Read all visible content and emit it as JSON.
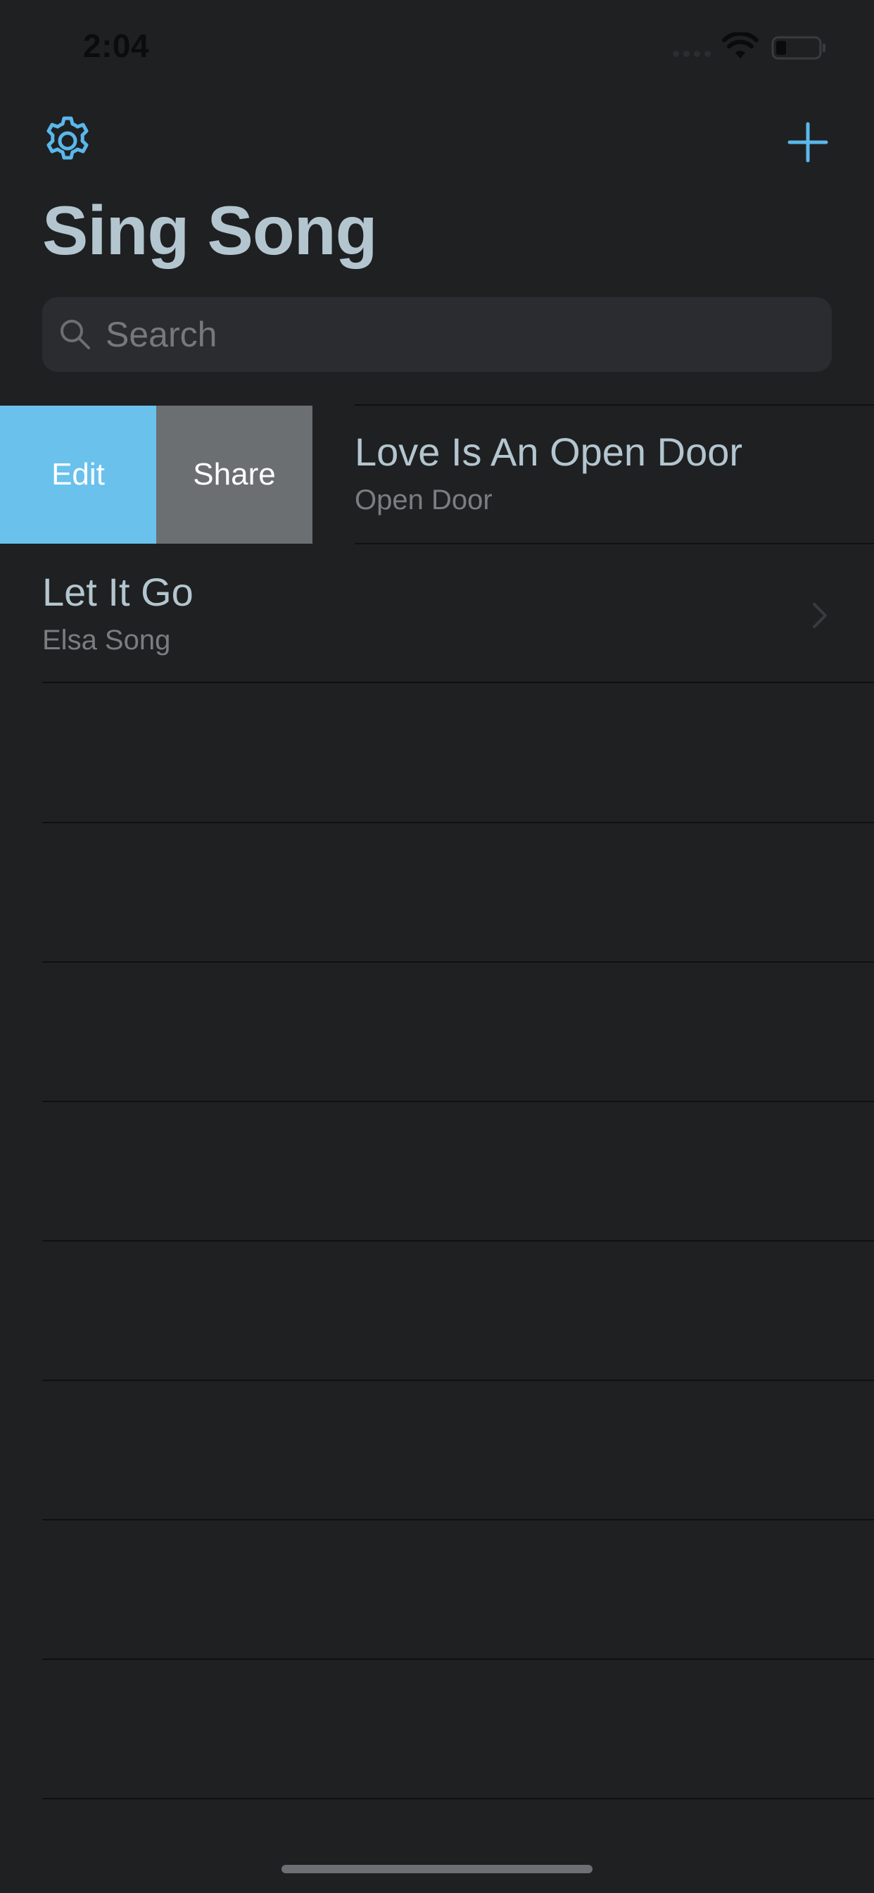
{
  "status_bar": {
    "time": "2:04"
  },
  "nav": {
    "settings_icon": "gear-icon",
    "add_icon": "plus-icon",
    "title": "Sing Song"
  },
  "search": {
    "placeholder": "Search",
    "icon": "search-icon"
  },
  "swipe_actions": {
    "edit_label": "Edit",
    "share_label": "Share",
    "edit_color": "#69c1ec",
    "share_color": "#6b6f72"
  },
  "songs": [
    {
      "title": "Love Is An Open Door",
      "subtitle": "Open Door"
    },
    {
      "title": "Let It Go",
      "subtitle": "Elsa Song"
    }
  ],
  "colors": {
    "accent": "#5ab7ea",
    "background": "#1f2022",
    "title_text": "#b3c6cf",
    "secondary_text": "#7c7d80"
  }
}
